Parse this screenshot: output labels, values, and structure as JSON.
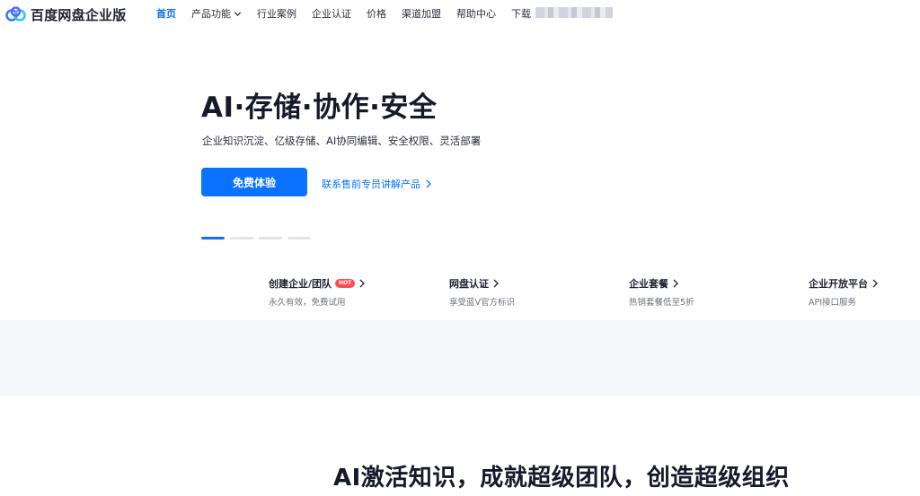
{
  "nav": {
    "brand": "百度网盘企业版",
    "items": [
      {
        "label": "首页",
        "active": true,
        "has_dropdown": false
      },
      {
        "label": "产品功能",
        "active": false,
        "has_dropdown": true
      },
      {
        "label": "行业案例",
        "active": false,
        "has_dropdown": false
      },
      {
        "label": "企业认证",
        "active": false,
        "has_dropdown": false
      },
      {
        "label": "价格",
        "active": false,
        "has_dropdown": false
      },
      {
        "label": "渠道加盟",
        "active": false,
        "has_dropdown": false
      },
      {
        "label": "帮助中心",
        "active": false,
        "has_dropdown": false
      },
      {
        "label": "下载",
        "active": false,
        "has_dropdown": false
      }
    ]
  },
  "hero": {
    "title": "AI·存储·协作·安全",
    "subtitle": "企业知识沉淀、亿级存储、AI协同编辑、安全权限、灵活部署",
    "primary_button": "免费体验",
    "secondary_link": "联系售前专员讲解产品",
    "carousel": {
      "total": 4,
      "active_index": 0
    }
  },
  "features": [
    {
      "title": "创建企业/团队",
      "desc": "永久有效，免费试用",
      "badge": "HOT"
    },
    {
      "title": "网盘认证",
      "desc": "享受蓝V官方标识"
    },
    {
      "title": "企业套餐",
      "desc": "热销套餐低至5折"
    },
    {
      "title": "企业开放平台",
      "desc": "API接口服务"
    }
  ],
  "section": {
    "title": "AI激活知识，成就超级团队，创造超级组织"
  },
  "colors": {
    "accent": "#0a72ff",
    "hot_badge": "#ff4d4f",
    "band_bg": "#f6f7fb"
  }
}
